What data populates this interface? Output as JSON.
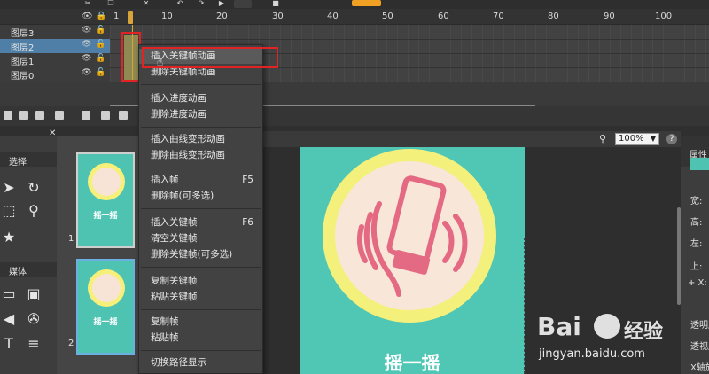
{
  "timeline": {
    "ruler_ticks": [
      "1",
      "10",
      "20",
      "30",
      "40",
      "50",
      "60",
      "70",
      "80",
      "90",
      "100"
    ],
    "layers": [
      {
        "name": "图层3",
        "selected": false
      },
      {
        "name": "图层2",
        "selected": true
      },
      {
        "name": "图层1",
        "selected": false
      },
      {
        "name": "图层0",
        "selected": false
      }
    ],
    "eye_icon": "eye-icon",
    "lock_icon": "lock-icon"
  },
  "tools": {
    "section_select": "选择",
    "section_media": "媒体",
    "text_tool": "T"
  },
  "pages": {
    "thumbnails": [
      {
        "number": "1",
        "caption": "摇一摇"
      },
      {
        "number": "2",
        "caption": "摇一摇"
      }
    ]
  },
  "canvas": {
    "zoom": "100%",
    "stage_caption": "摇一摇",
    "help": "?"
  },
  "props": {
    "title": "属性",
    "labels": [
      "宽:",
      "高:",
      "左:",
      "上:",
      "+ X:",
      "透明度",
      "透视度",
      "X轴旋"
    ]
  },
  "context_menu": {
    "items": [
      {
        "label": "插入关键帧动画",
        "shortcut": "",
        "hover": true
      },
      {
        "label": "删除关键帧动画",
        "shortcut": ""
      },
      {
        "label": "插入进度动画",
        "shortcut": ""
      },
      {
        "label": "删除进度动画",
        "shortcut": ""
      },
      {
        "label": "插入曲线变形动画",
        "shortcut": ""
      },
      {
        "label": "删除曲线变形动画",
        "shortcut": ""
      },
      {
        "label": "插入帧",
        "shortcut": "F5"
      },
      {
        "label": "删除帧(可多选)",
        "shortcut": ""
      },
      {
        "label": "插入关键帧",
        "shortcut": "F6"
      },
      {
        "label": "清空关键帧",
        "shortcut": ""
      },
      {
        "label": "删除关键帧(可多选)",
        "shortcut": ""
      },
      {
        "label": "复制关键帧",
        "shortcut": ""
      },
      {
        "label": "粘贴关键帧",
        "shortcut": ""
      },
      {
        "label": "复制帧",
        "shortcut": ""
      },
      {
        "label": "粘贴帧",
        "shortcut": ""
      },
      {
        "label": "切换路径显示",
        "shortcut": ""
      }
    ]
  },
  "watermark": {
    "logo": "Bai",
    "brand_cn": "经验",
    "url": "jingyan.baidu.com"
  },
  "colors": {
    "accent_teal": "#50c6b5",
    "highlight_red": "#e02424",
    "selection_blue": "#4f7fa6"
  }
}
